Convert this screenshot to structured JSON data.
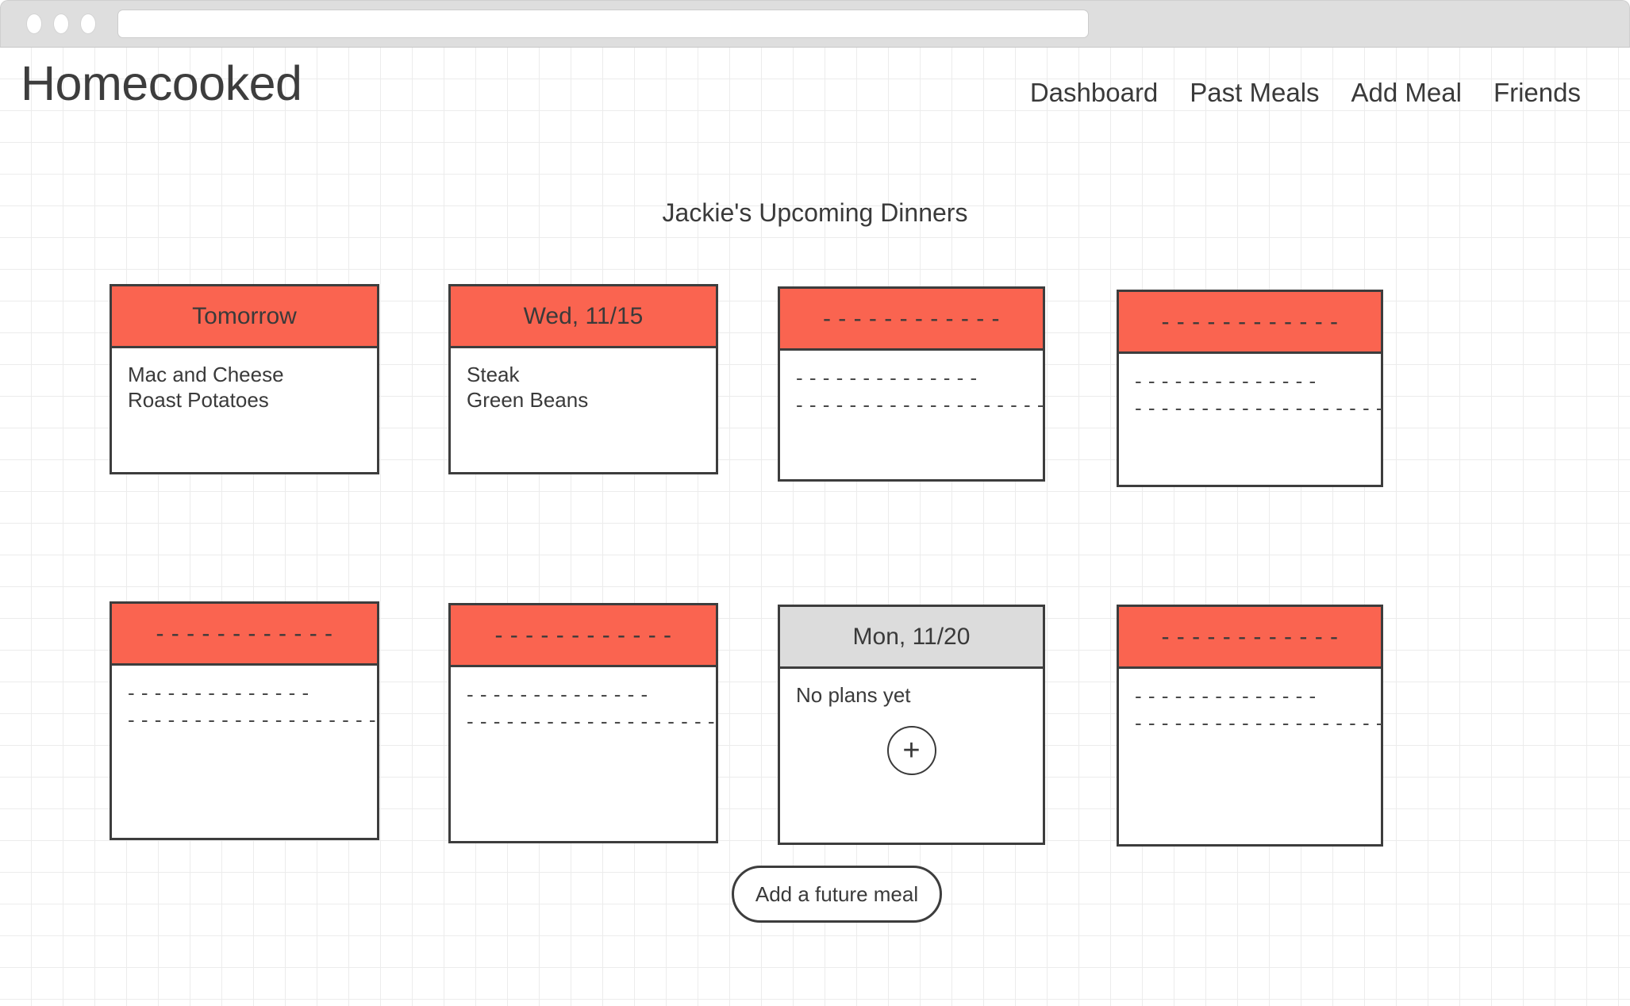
{
  "browser": {
    "url_value": "",
    "url_placeholder": "",
    "dots": [
      "close-dot",
      "minimize-dot",
      "maximize-dot"
    ]
  },
  "header": {
    "app_title": "Homecooked",
    "nav": [
      {
        "label": "Dashboard",
        "name": "nav-dashboard"
      },
      {
        "label": "Past Meals",
        "name": "nav-past-meals"
      },
      {
        "label": "Add Meal",
        "name": "nav-add-meal"
      },
      {
        "label": "Friends",
        "name": "nav-friends"
      }
    ]
  },
  "main": {
    "page_title": "Jackie's Upcoming Dinners",
    "add_future_meal_label": "Add a future meal",
    "add_meal_plus_label": "+",
    "colors": {
      "header_orange": "#fa6450",
      "header_grey": "#dcdcdc",
      "border": "#3d3d3d",
      "text": "#3a3a3a",
      "grid_line": "#ececec"
    },
    "cards": [
      {
        "title": "Tomorrow",
        "header_style": "orange",
        "is_placeholder": false,
        "lines": [
          "Mac and Cheese",
          "Roast Potatoes"
        ]
      },
      {
        "title": "Wed, 11/15",
        "header_style": "orange",
        "is_placeholder": false,
        "lines": [
          "Steak",
          "Green Beans"
        ]
      },
      {
        "title": "- - - - - - - - - - - -",
        "header_style": "orange",
        "is_placeholder": true,
        "lines": [
          "- - - - - - - - - - - - - -",
          "- - - - - - - - - - - - - - - - - - -"
        ]
      },
      {
        "title": "- - - - - - - - - - - -",
        "header_style": "orange",
        "is_placeholder": true,
        "lines": [
          "- - - - - - - - - - - - - -",
          "- - - - - - - - - - - - - - - - - - -"
        ]
      },
      {
        "title": "- - - - - - - - - - - -",
        "header_style": "orange",
        "is_placeholder": true,
        "lines": [
          "- - - - - - - - - - - - - -",
          "- - - - - - - - - - - - - - - - - - -"
        ]
      },
      {
        "title": "- - - - - - - - - - - -",
        "header_style": "orange",
        "is_placeholder": true,
        "lines": [
          "- - - - - - - - - - - - - -",
          "- - - - - - - - - - - - - - - - - - -"
        ]
      },
      {
        "title": "Mon, 11/20",
        "header_style": "grey",
        "is_placeholder": false,
        "empty_label": "No plans yet",
        "has_add_button": true,
        "lines": []
      },
      {
        "title": "- - - - - - - - - - - -",
        "header_style": "orange",
        "is_placeholder": true,
        "lines": [
          "- - - - - - - - - - - - - -",
          "- - - - - - - - - - - - - - - - - - -"
        ]
      }
    ]
  }
}
